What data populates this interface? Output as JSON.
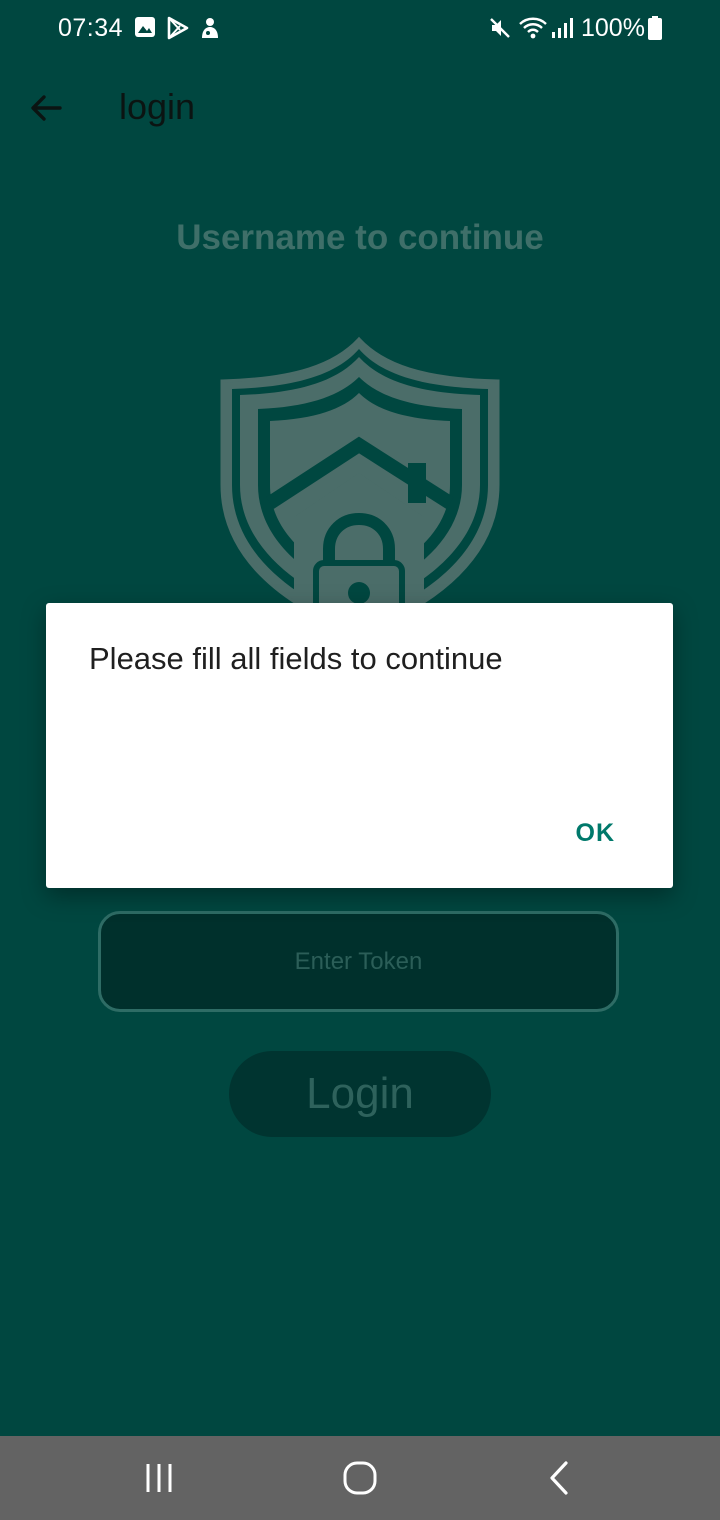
{
  "status_bar": {
    "time": "07:34",
    "battery": "100%",
    "icons_left": [
      "gallery-icon",
      "play-store-icon",
      "notification-app-icon"
    ],
    "icons_right": [
      "mute-icon",
      "wifi-icon",
      "signal-icon",
      "battery-icon"
    ]
  },
  "app_bar": {
    "title": "login",
    "back_icon": "arrow-left-icon"
  },
  "main": {
    "headline": "Username to continue",
    "token_placeholder": "Enter Token",
    "login_label": "Login"
  },
  "dialog": {
    "message": "Please fill all fields to continue",
    "ok_label": "OK"
  },
  "nav_bar": {
    "buttons": [
      "recents-icon",
      "home-icon",
      "back-icon"
    ]
  },
  "colors": {
    "background": "#004740",
    "dialog_accent": "#00796b",
    "nav_bar": "#636363"
  }
}
